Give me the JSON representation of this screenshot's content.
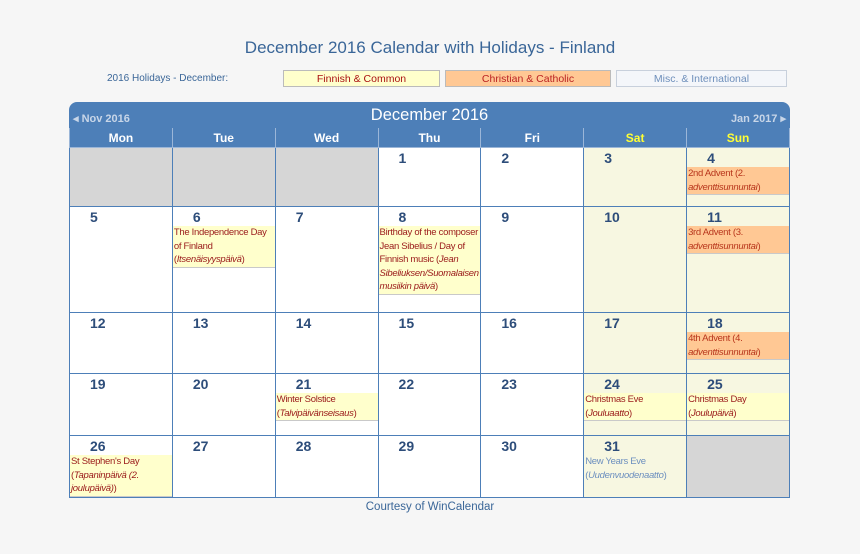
{
  "page_title": "December 2016 Calendar with Holidays - Finland",
  "legend": {
    "label": "2016 Holidays - December:",
    "items": [
      {
        "label": "Finnish & Common",
        "color": "#ffffcc"
      },
      {
        "label": "Christian & Catholic",
        "color": "#ffc894"
      },
      {
        "label": "Misc. & International",
        "color": "#f4f6fa"
      }
    ]
  },
  "calendar": {
    "month_title": "December 2016",
    "prev_label": "◂ Nov 2016",
    "next_label": "Jan 2017 ▸",
    "weekdays": [
      "Mon",
      "Tue",
      "Wed",
      "Thu",
      "Fri",
      "Sat",
      "Sun"
    ],
    "weeks": [
      [
        {
          "day": ""
        },
        {
          "day": ""
        },
        {
          "day": ""
        },
        {
          "day": "1"
        },
        {
          "day": "2"
        },
        {
          "day": "3"
        },
        {
          "day": "4",
          "event": {
            "type": "christian",
            "text": "2nd Advent (2. ",
            "italic": "adventtisunnuntai",
            "after": ")"
          }
        }
      ],
      [
        {
          "day": "5"
        },
        {
          "day": "6",
          "event": {
            "type": "finnish",
            "text": "The Independence Day of Finland (",
            "italic": "Itsenäisyyspäivä",
            "after": ")"
          }
        },
        {
          "day": "7"
        },
        {
          "day": "8",
          "event": {
            "type": "finnish",
            "text": "Birthday of the composer Jean Sibelius / Day of Finnish music (",
            "italic": "Jean Sibeliuksen/Suomalaisen musiikin päivä",
            "after": ")"
          }
        },
        {
          "day": "9"
        },
        {
          "day": "10"
        },
        {
          "day": "11",
          "event": {
            "type": "christian",
            "text": "3rd Advent (3. ",
            "italic": "adventtisunnuntai",
            "after": ")"
          }
        }
      ],
      [
        {
          "day": "12"
        },
        {
          "day": "13"
        },
        {
          "day": "14"
        },
        {
          "day": "15"
        },
        {
          "day": "16"
        },
        {
          "day": "17"
        },
        {
          "day": "18",
          "event": {
            "type": "christian",
            "text": "4th Advent (4. ",
            "italic": "adventtisunnuntai",
            "after": ")"
          }
        }
      ],
      [
        {
          "day": "19"
        },
        {
          "day": "20"
        },
        {
          "day": "21",
          "event": {
            "type": "finnish",
            "text": "Winter Solstice (",
            "italic": "Talvipäivänseisaus",
            "after": ")"
          }
        },
        {
          "day": "22"
        },
        {
          "day": "23"
        },
        {
          "day": "24",
          "event": {
            "type": "finnish",
            "text": "Christmas Eve (",
            "italic": "Jouluaatto",
            "after": ")"
          }
        },
        {
          "day": "25",
          "event": {
            "type": "finnish",
            "text": "Christmas Day (",
            "italic": "Joulupäivä",
            "after": ")"
          }
        }
      ],
      [
        {
          "day": "26",
          "event": {
            "type": "finnish",
            "text": "St Stephen's Day (",
            "italic": "Tapaninpäivä (2. joulupäivä)",
            "after": ")"
          }
        },
        {
          "day": "27"
        },
        {
          "day": "28"
        },
        {
          "day": "29"
        },
        {
          "day": "30"
        },
        {
          "day": "31",
          "event": {
            "type": "misc",
            "text": "New Years Eve (",
            "italic": "Uudenvuodenaatto",
            "after": ")"
          }
        },
        {
          "day": ""
        }
      ]
    ]
  },
  "footer": "Courtesy of WinCalendar"
}
